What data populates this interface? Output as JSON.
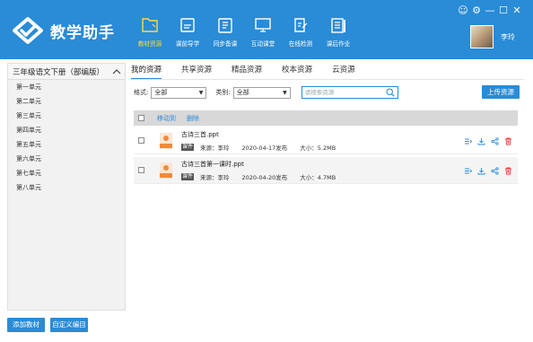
{
  "app": {
    "title": "教学助手",
    "window_controls": [
      "☺",
      "⚙",
      "—",
      "☐",
      "✕"
    ],
    "accent_color": "#2a8bd6",
    "active_color": "#ffd94a"
  },
  "nav": [
    {
      "label": "教材资源",
      "icon": "textbook-resource-icon",
      "active": true
    },
    {
      "label": "课前导学",
      "icon": "preview-guide-icon",
      "active": false
    },
    {
      "label": "同步备课",
      "icon": "sync-prep-icon",
      "active": false
    },
    {
      "label": "互动课堂",
      "icon": "interactive-class-icon",
      "active": false
    },
    {
      "label": "在线检测",
      "icon": "online-test-icon",
      "active": false
    },
    {
      "label": "课后作业",
      "icon": "homework-icon",
      "active": false
    }
  ],
  "user": {
    "name": "李玲"
  },
  "sidebar": {
    "title": "三年级语文下册（部编版）",
    "items": [
      "第一单元",
      "第二单元",
      "第三单元",
      "第四单元",
      "第五单元",
      "第六单元",
      "第七单元",
      "第八单元"
    ],
    "add_button": "添加教材",
    "custom_button": "自定义编目"
  },
  "tabs": [
    "我的资源",
    "共享资源",
    "精品资源",
    "校本资源",
    "云资源"
  ],
  "filters": {
    "format_label": "格式:",
    "format_value": "全部",
    "category_label": "类别:",
    "category_value": "全部",
    "search_placeholder": "请搜索资源",
    "upload_button": "上传资源"
  },
  "list": {
    "actions": [
      "移动到",
      "删除"
    ],
    "rows": [
      {
        "name": "古诗三首.ppt",
        "tag": "课件",
        "source": "来源：李玲",
        "date": "2020-04-17发布",
        "size": "大小：5.2MB"
      },
      {
        "name": "古诗三首第一课时.ppt",
        "tag": "课件",
        "source": "来源：李玲",
        "date": "2020-04-20发布",
        "size": "大小：4.7MB"
      }
    ]
  }
}
